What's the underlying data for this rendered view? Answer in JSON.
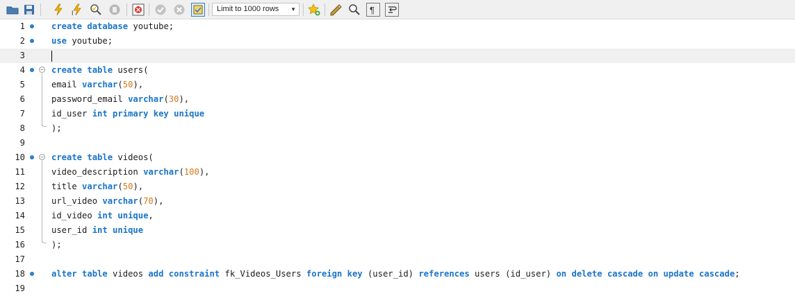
{
  "toolbar": {
    "icons_left": [
      "open-folder-icon",
      "save-icon",
      "execute-icon",
      "execute-current-icon",
      "explain-icon",
      "stop-icon",
      "toggle-errors-icon",
      "commit-icon",
      "rollback-icon",
      "autocommit-icon"
    ],
    "limit": {
      "label": "Limit to 1000 rows"
    },
    "icons_right": [
      "add-snippet-icon",
      "beautify-icon",
      "find-icon",
      "invisible-chars-icon",
      "wrap-icon"
    ]
  },
  "editor": {
    "current_line": 3,
    "lines": [
      {
        "num": "1",
        "dot": true,
        "fold": false,
        "tokens": [
          [
            "kw",
            "create"
          ],
          [
            "id",
            " "
          ],
          [
            "kw",
            "database"
          ],
          [
            "id",
            " youtube;"
          ]
        ]
      },
      {
        "num": "2",
        "dot": true,
        "fold": false,
        "tokens": [
          [
            "kw",
            "use"
          ],
          [
            "id",
            " youtube;"
          ]
        ]
      },
      {
        "num": "3",
        "dot": false,
        "fold": false,
        "tokens": []
      },
      {
        "num": "4",
        "dot": true,
        "fold": true,
        "tokens": [
          [
            "kw",
            "create"
          ],
          [
            "id",
            " "
          ],
          [
            "kw",
            "table"
          ],
          [
            "id",
            " users("
          ]
        ]
      },
      {
        "num": "5",
        "dot": false,
        "fold": false,
        "tokens": [
          [
            "id",
            "email "
          ],
          [
            "kw",
            "varchar"
          ],
          [
            "id",
            "("
          ],
          [
            "num",
            "50"
          ],
          [
            "id",
            "),"
          ]
        ]
      },
      {
        "num": "6",
        "dot": false,
        "fold": false,
        "tokens": [
          [
            "id",
            "password_email "
          ],
          [
            "kw",
            "varchar"
          ],
          [
            "id",
            "("
          ],
          [
            "num",
            "30"
          ],
          [
            "id",
            "),"
          ]
        ]
      },
      {
        "num": "7",
        "dot": false,
        "fold": false,
        "tokens": [
          [
            "id",
            "id_user "
          ],
          [
            "kw",
            "int primary key unique"
          ]
        ]
      },
      {
        "num": "8",
        "dot": false,
        "fold": false,
        "tokens": [
          [
            "id",
            ");"
          ]
        ]
      },
      {
        "num": "9",
        "dot": false,
        "fold": false,
        "tokens": []
      },
      {
        "num": "10",
        "dot": true,
        "fold": true,
        "tokens": [
          [
            "kw",
            "create"
          ],
          [
            "id",
            " "
          ],
          [
            "kw",
            "table"
          ],
          [
            "id",
            " videos("
          ]
        ]
      },
      {
        "num": "11",
        "dot": false,
        "fold": false,
        "tokens": [
          [
            "id",
            "video_description "
          ],
          [
            "kw",
            "varchar"
          ],
          [
            "id",
            "("
          ],
          [
            "num",
            "100"
          ],
          [
            "id",
            "),"
          ]
        ]
      },
      {
        "num": "12",
        "dot": false,
        "fold": false,
        "tokens": [
          [
            "id",
            "title "
          ],
          [
            "kw",
            "varchar"
          ],
          [
            "id",
            "("
          ],
          [
            "num",
            "50"
          ],
          [
            "id",
            "),"
          ]
        ]
      },
      {
        "num": "13",
        "dot": false,
        "fold": false,
        "tokens": [
          [
            "id",
            "url_video "
          ],
          [
            "kw",
            "varchar"
          ],
          [
            "id",
            "("
          ],
          [
            "num",
            "70"
          ],
          [
            "id",
            "),"
          ]
        ]
      },
      {
        "num": "14",
        "dot": false,
        "fold": false,
        "tokens": [
          [
            "id",
            "id_video "
          ],
          [
            "kw",
            "int unique"
          ],
          [
            "id",
            ","
          ]
        ]
      },
      {
        "num": "15",
        "dot": false,
        "fold": false,
        "tokens": [
          [
            "id",
            "user_id "
          ],
          [
            "kw",
            "int unique"
          ]
        ]
      },
      {
        "num": "16",
        "dot": false,
        "fold": false,
        "tokens": [
          [
            "id",
            ");"
          ]
        ]
      },
      {
        "num": "17",
        "dot": false,
        "fold": false,
        "tokens": []
      },
      {
        "num": "18",
        "dot": true,
        "fold": false,
        "tokens": [
          [
            "kw",
            "alter table"
          ],
          [
            "id",
            " videos "
          ],
          [
            "kw",
            "add constraint"
          ],
          [
            "id",
            " fk_Videos_Users "
          ],
          [
            "kw",
            "foreign key"
          ],
          [
            "id",
            " (user_id) "
          ],
          [
            "kw",
            "references"
          ],
          [
            "id",
            " users (id_user) "
          ],
          [
            "kw",
            "on delete cascade on update cascade"
          ],
          [
            "id",
            ";"
          ]
        ]
      },
      {
        "num": "19",
        "dot": false,
        "fold": false,
        "tokens": []
      }
    ]
  }
}
